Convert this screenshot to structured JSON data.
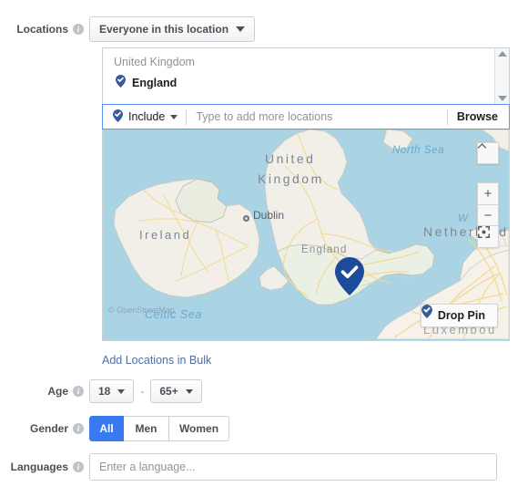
{
  "locations": {
    "label": "Locations",
    "info_icon": "info-icon",
    "audience_dropdown": {
      "value": "Everyone in this location",
      "caret_icon": "chevron-down-icon"
    },
    "selected": {
      "country": "United Kingdom",
      "items": [
        {
          "name": "England",
          "pin_icon": "map-pin-check-icon"
        }
      ]
    },
    "scrollbar": {
      "up_icon": "scroll-up-arrow-icon",
      "down_icon": "scroll-down-arrow-icon"
    },
    "include_dropdown": {
      "value": "Include",
      "pin_icon": "map-pin-check-icon",
      "caret_icon": "chevron-down-icon"
    },
    "search_input": {
      "value": "",
      "placeholder": "Type to add more locations"
    },
    "browse_label": "Browse",
    "bulk_link": "Add Locations in Bulk"
  },
  "map": {
    "attribution": "© OpenStreetMap",
    "country_labels": [
      "United Kingdom",
      "Ireland",
      "England",
      "Netherland",
      "Luxembou"
    ],
    "sea_labels": [
      "North Sea",
      "Celtic Sea",
      "W                n"
    ],
    "cities": [
      {
        "name": "Dublin"
      }
    ],
    "pin_icon": "map-pin-check-icon",
    "controls": {
      "collapse": {
        "icon": "chevron-up-icon",
        "label": ""
      },
      "zoom_in": {
        "icon": "plus-icon",
        "label": "+"
      },
      "zoom_out": {
        "icon": "minus-icon",
        "label": "−"
      },
      "fullscreen": {
        "icon": "fullscreen-expand-icon",
        "label": ""
      }
    },
    "drop_pin_button": {
      "label": "Drop Pin",
      "icon": "map-pin-check-icon"
    },
    "colors": {
      "water": "#aad3e3",
      "land": "#f2efe9",
      "road": "#f6d98a",
      "green": "#d6e7c8"
    }
  },
  "age": {
    "label": "Age",
    "info_icon": "info-icon",
    "min": "18",
    "max": "65+",
    "separator": "-",
    "caret_icon": "chevron-down-icon"
  },
  "gender": {
    "label": "Gender",
    "info_icon": "info-icon",
    "options": [
      {
        "label": "All",
        "selected": true
      },
      {
        "label": "Men",
        "selected": false
      },
      {
        "label": "Women",
        "selected": false
      }
    ],
    "accent_color": "#3b79f0"
  },
  "languages": {
    "label": "Languages",
    "info_icon": "info-icon",
    "input": {
      "value": "",
      "placeholder": "Enter a language..."
    }
  }
}
